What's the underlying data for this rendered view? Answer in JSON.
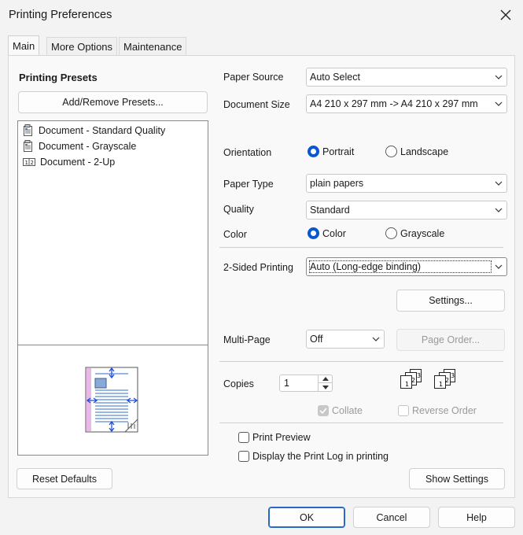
{
  "window": {
    "title": "Printing Preferences"
  },
  "tabs": [
    {
      "label": "Main"
    },
    {
      "label": "More Options"
    },
    {
      "label": "Maintenance"
    }
  ],
  "presets": {
    "heading": "Printing Presets",
    "add_remove_label": "Add/Remove Presets...",
    "items": [
      {
        "label": "Document - Standard Quality"
      },
      {
        "label": "Document - Grayscale"
      },
      {
        "label": "Document - 2-Up"
      }
    ]
  },
  "settings": {
    "paper_source": {
      "label": "Paper Source",
      "value": "Auto Select"
    },
    "document_size": {
      "label": "Document Size",
      "value": "A4 210 x 297 mm -> A4 210 x 297 mm"
    },
    "orientation": {
      "label": "Orientation",
      "portrait": "Portrait",
      "landscape": "Landscape"
    },
    "paper_type": {
      "label": "Paper Type",
      "value": "plain papers"
    },
    "quality": {
      "label": "Quality",
      "value": "Standard"
    },
    "color": {
      "label": "Color",
      "color": "Color",
      "grayscale": "Grayscale"
    },
    "two_sided": {
      "label": "2-Sided Printing",
      "value": "Auto (Long-edge binding)",
      "settings_label": "Settings..."
    },
    "multi_page": {
      "label": "Multi-Page",
      "value": "Off",
      "page_order_label": "Page Order..."
    },
    "copies": {
      "label": "Copies",
      "value": "1",
      "collate": "Collate",
      "reverse_order": "Reverse Order"
    },
    "print_preview": "Print Preview",
    "print_log": "Display the Print Log in printing"
  },
  "buttons": {
    "reset_defaults": "Reset Defaults",
    "show_settings": "Show Settings",
    "ok": "OK",
    "cancel": "Cancel",
    "help": "Help"
  },
  "colors": {
    "accent": "#0b57d0",
    "focus_border": "#2a68c7",
    "preview_margin": "#e9b8e9",
    "preview_lines": "#2f6fcf"
  }
}
